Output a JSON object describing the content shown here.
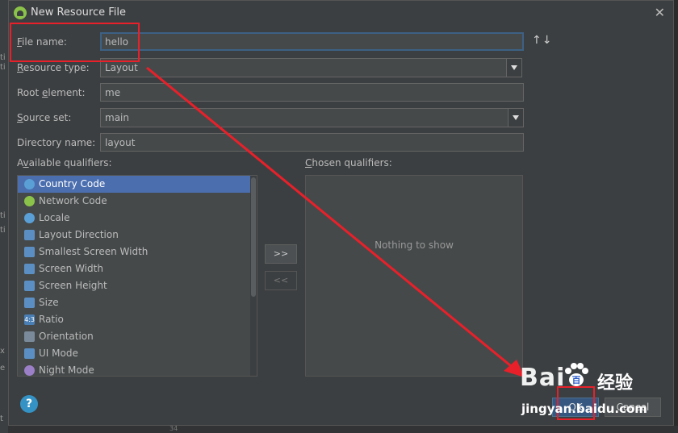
{
  "background_ide": {
    "left_fragments": [
      "ti",
      "ti",
      "ti",
      "ti",
      "x",
      "e",
      "t"
    ],
    "bottom_fragment": "34"
  },
  "dialog": {
    "title": "New Resource File",
    "close_glyph": "✕",
    "fields": {
      "file_name": {
        "mnemonic": "F",
        "label_rest": "ile name:",
        "value": "hello"
      },
      "resource_type": {
        "mnemonic": "R",
        "label_rest": "esource type:",
        "value": "Layout"
      },
      "root_element": {
        "label_pre": "Root ",
        "mnemonic": "e",
        "label_rest": "lement:",
        "value": "me"
      },
      "source_set": {
        "mnemonic": "S",
        "label_rest": "ource set:",
        "value": "main"
      },
      "directory_name": {
        "label": "Directory name:",
        "value": "layout"
      }
    },
    "sort_glyph": "↑↓",
    "available_qualifiers": {
      "label_pre": "A",
      "mnemonic": "v",
      "label_rest": "ailable qualifiers:",
      "items": [
        {
          "label": "Country Code",
          "icon": "globe-icon",
          "color": "#5aa0d6",
          "selected": true
        },
        {
          "label": "Network Code",
          "icon": "network-icon",
          "color": "#8bc34a"
        },
        {
          "label": "Locale",
          "icon": "globe-icon",
          "color": "#5aa0d6"
        },
        {
          "label": "Layout Direction",
          "icon": "direction-icon",
          "color": "#5b8fc4"
        },
        {
          "label": "Smallest Screen Width",
          "icon": "resize-icon",
          "color": "#5b8fc4"
        },
        {
          "label": "Screen Width",
          "icon": "width-icon",
          "color": "#5b8fc4"
        },
        {
          "label": "Screen Height",
          "icon": "height-icon",
          "color": "#5b8fc4"
        },
        {
          "label": "Size",
          "icon": "size-icon",
          "color": "#5b8fc4"
        },
        {
          "label": "Ratio",
          "icon": "ratio-icon",
          "color": "#4a7fb5",
          "glyph": "4:3"
        },
        {
          "label": "Orientation",
          "icon": "orientation-icon",
          "color": "#7a8a9a"
        },
        {
          "label": "UI Mode",
          "icon": "ui-mode-icon",
          "color": "#5b8fc4"
        },
        {
          "label": "Night Mode",
          "icon": "night-mode-icon",
          "color": "#9b7fc7"
        }
      ]
    },
    "move_buttons": {
      "add": ">>",
      "remove": "<<"
    },
    "chosen_qualifiers": {
      "mnemonic": "C",
      "label_rest": "hosen qualifiers:",
      "empty_text": "Nothing to show"
    },
    "help": "?",
    "buttons": {
      "ok": "OK",
      "cancel": "Cancel"
    }
  },
  "watermark": {
    "brand": "Bai",
    "brand_end": "百",
    "cn": "经验",
    "url": "jingyan.baidu.com"
  },
  "annotation_color": "#e8202a"
}
